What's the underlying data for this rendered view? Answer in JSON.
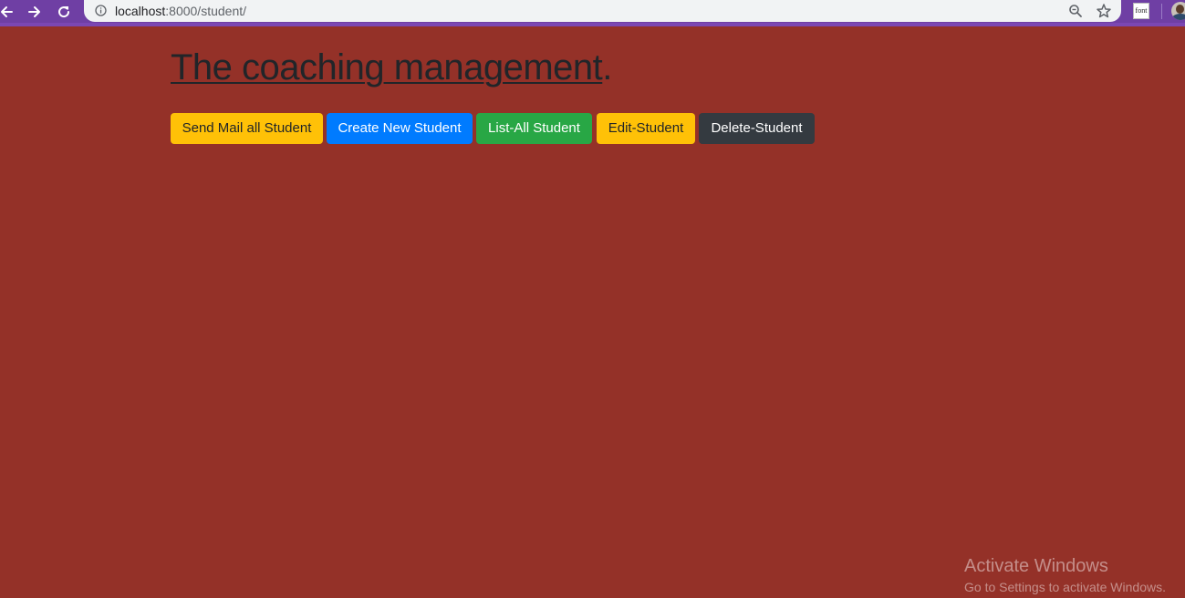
{
  "browser": {
    "url_host": "localhost",
    "url_path": ":8000/student/",
    "extension_label": "font",
    "icons": {
      "back": "arrow-left-icon",
      "forward": "arrow-right-icon",
      "reload": "reload-icon",
      "site_info": "info-icon",
      "zoom": "zoom-icon",
      "bookmark": "star-icon"
    },
    "colors": {
      "frame": "#6f3fa4",
      "omnibox": "#f1f3f4"
    }
  },
  "page": {
    "title_link": "The coaching management",
    "title_suffix": ".",
    "background": "#943128",
    "buttons": [
      {
        "label": "Send Mail all Student",
        "color": "#ffc107"
      },
      {
        "label": "Create New Student",
        "color": "#007bff"
      },
      {
        "label": "List-All Student",
        "color": "#28a745"
      },
      {
        "label": "Edit-Student",
        "color": "#ffc107"
      },
      {
        "label": "Delete-Student",
        "color": "#343a40"
      }
    ]
  },
  "watermark": {
    "title": "Activate Windows",
    "subtitle": "Go to Settings to activate Windows."
  }
}
